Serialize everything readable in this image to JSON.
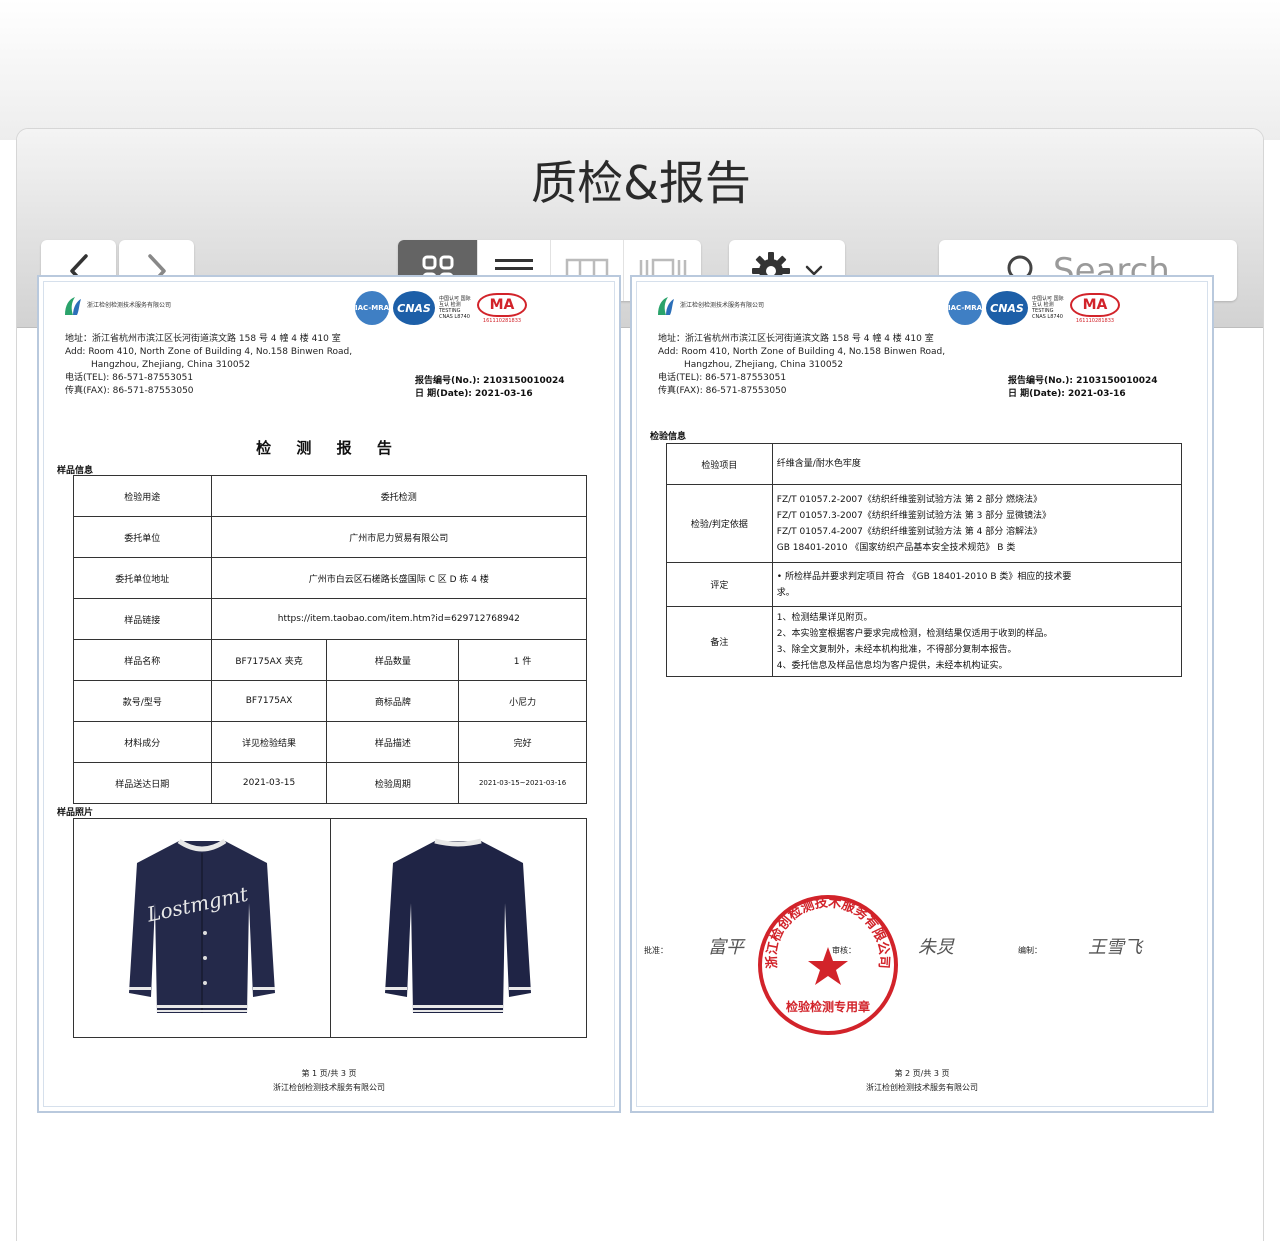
{
  "window": {
    "title": "质检&报告"
  },
  "toolbar": {
    "search_placeholder": "Search"
  },
  "icons": {
    "back": "chevron-left-icon",
    "forward": "chevron-right-icon",
    "grid": "grid-view-icon",
    "list": "list-view-icon",
    "columns": "column-view-icon",
    "gallery": "gallery-view-icon",
    "gear": "gear-icon",
    "dropdown": "chevron-down-icon",
    "search": "search-icon"
  },
  "colors": {
    "active_segment": "#646464",
    "seal_red": "#d2232a",
    "cnas_blue": "#1d5fa8"
  },
  "documents": [
    {
      "address_lines": [
        "地址：浙江省杭州市滨江区长河街道滨文路 158 号 4 幢 4 楼 410 室",
        "Add: Room 410, North Zone of Building 4, No.158 Binwen Road,",
        "Hangzhou, Zhejiang, China          310052",
        "电话(TEL):    86-571-87553051",
        "传真(FAX):    86-571-87553050"
      ],
      "report_no": "报告编号(No.): 2103150010024",
      "report_date": "日    期(Date): 2021-03-16",
      "heading": "检 测 报 告",
      "section_sample_info": "样品信息",
      "sample_rows": [
        {
          "label": "检验用途",
          "value": "委托检测"
        },
        {
          "label": "委托单位",
          "value": "广州市尼力贸易有限公司"
        },
        {
          "label": "委托单位地址",
          "value": "广州市白云区石槎路长盛国际 C 区 D 栋 4 楼"
        },
        {
          "label": "样品链接",
          "value": "https://item.taobao.com/item.htm?id=629712768942"
        }
      ],
      "sample_grid": [
        [
          "样品名称",
          "BF7175AX 夹克",
          "样品数量",
          "1 件"
        ],
        [
          "款号/型号",
          "BF7175AX",
          "商标品牌",
          "小尼力"
        ],
        [
          "材料成分",
          "详见检验结果",
          "样品描述",
          "完好"
        ],
        [
          "样品送达日期",
          "2021-03-15",
          "检验周期",
          "2021-03-15~2021-03-16"
        ]
      ],
      "section_photo": "样品照片",
      "jacket_text": "Lostmgmt",
      "footer_page": "第 1 页/共 3 页",
      "footer_org": "浙江检创检测技术服务有限公司"
    },
    {
      "address_lines": [
        "地址：浙江省杭州市滨江区长河街道滨文路 158 号 4 幢 4 楼 410 室",
        "Add: Room 410, North Zone of Building 4, No.158 Binwen Road,",
        "Hangzhou, Zhejiang, China          310052",
        "电话(TEL):    86-571-87553051",
        "传真(FAX):    86-571-87553050"
      ],
      "report_no": "报告编号(No.): 2103150010024",
      "report_date": "日    期(Date): 2021-03-16",
      "section_test_info": "检验信息",
      "test_rows": [
        {
          "label": "检验项目",
          "lines": [
            "纤维含量/耐水色牢度"
          ]
        },
        {
          "label": "检验/判定依据",
          "lines": [
            "FZ/T 01057.2-2007《纺织纤维鉴别试验方法 第 2 部分 燃烧法》",
            "FZ/T 01057.3-2007《纺织纤维鉴别试验方法 第 3 部分 显微镜法》",
            "FZ/T 01057.4-2007《纺织纤维鉴别试验方法 第 4 部分 溶解法》",
            "GB 18401-2010 《国家纺织产品基本安全技术规范》 B 类"
          ]
        },
        {
          "label": "评定",
          "lines": [
            "• 所检样品并要求判定项目 符合 《GB 18401-2010 B 类》相应的技术要",
            "求。"
          ]
        },
        {
          "label": "备注",
          "lines": [
            "1、检测结果详见附页。",
            "2、本实验室根据客户要求完成检测，检测结果仅适用于收到的样品。",
            "3、除全文复制外，未经本机构批准，不得部分复制本报告。",
            "4、委托信息及样品信息均为客户提供，未经本机构证实。"
          ]
        }
      ],
      "sign_approve": "批准：",
      "sign_review": "审核：",
      "sign_compile": "编制：",
      "seal_text": "浙江检创检测技术服务有限公司",
      "seal_bottom": "检验检测专用章",
      "footer_page": "第 2 页/共 3 页",
      "footer_org": "浙江检创检测技术服务有限公司"
    }
  ],
  "logo": {
    "org_small": "浙江检创检测技术服务有限公司",
    "cert_iac": "IAC-MRA",
    "cert_cnas": "CNAS",
    "cert_cnas_text": "中国认可 国际互认 检测 TESTING CNAS L8740",
    "cert_ma": "MA",
    "cert_ma_no": "161110281833"
  }
}
